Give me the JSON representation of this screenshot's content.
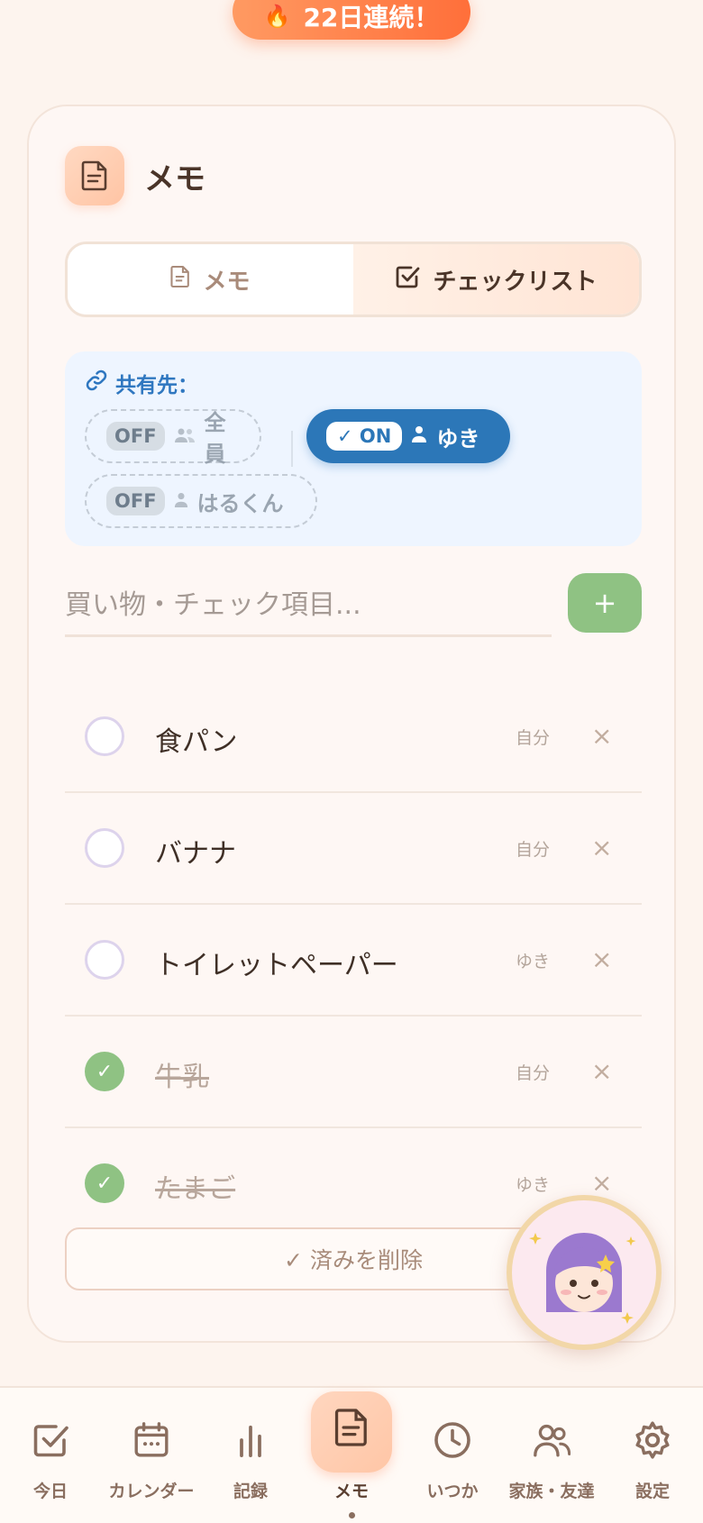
{
  "streak": {
    "icon": "fire-icon",
    "label": "22日連続！"
  },
  "card": {
    "title": "メモ",
    "tabs": [
      {
        "label": "メモ",
        "icon": "document-icon",
        "active": false
      },
      {
        "label": "チェックリスト",
        "icon": "checkbox-icon",
        "active": true
      }
    ],
    "share": {
      "label": "共有先：",
      "chips": [
        {
          "state": "OFF",
          "name": "全員",
          "icon": "group-icon",
          "on": false
        },
        {
          "state": "✓ ON",
          "name": "ゆき",
          "icon": "person-icon",
          "on": true
        },
        {
          "state": "OFF",
          "name": "はるくん",
          "icon": "person-icon",
          "on": false
        }
      ]
    },
    "add": {
      "placeholder": "買い物・チェック項目...",
      "button": "+"
    },
    "items": [
      {
        "text": "食パン",
        "owner": "自分",
        "done": false
      },
      {
        "text": "バナナ",
        "owner": "自分",
        "done": false
      },
      {
        "text": "トイレットペーパー",
        "owner": "ゆき",
        "done": false
      },
      {
        "text": "牛乳",
        "owner": "自分",
        "done": true
      },
      {
        "text": "たまご",
        "owner": "ゆき",
        "done": true
      }
    ],
    "delete_x": "×",
    "check_mark": "✓",
    "clear_label": "✓ 済みを削除"
  },
  "nav": {
    "items": [
      {
        "label": "今日",
        "icon": "checkbox-icon"
      },
      {
        "label": "カレンダー",
        "icon": "calendar-icon"
      },
      {
        "label": "記録",
        "icon": "bar-chart-icon"
      },
      {
        "label": "メモ",
        "icon": "document-icon",
        "active": true
      },
      {
        "label": "いつか",
        "icon": "clock-icon"
      },
      {
        "label": "家族・友達",
        "icon": "people-icon"
      },
      {
        "label": "設定",
        "icon": "gear-icon"
      }
    ]
  },
  "colors": {
    "accent": "#ff7a45",
    "share_blue": "#2c77b8",
    "check_green": "#8fc283"
  }
}
